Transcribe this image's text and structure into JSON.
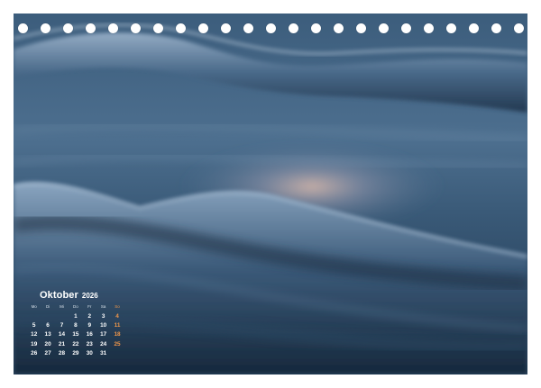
{
  "photo": {
    "subject": "long-exposure-sea-waves",
    "colors": {
      "deep": "#1c2f45",
      "mid": "#3d6080",
      "light": "#7d9cb8",
      "glow": "#d9b3a4"
    }
  },
  "binding": {
    "hole_count": 23
  },
  "calendar": {
    "month": "Oktober",
    "year": "2026",
    "weekdays": [
      "Mo",
      "Di",
      "Mi",
      "Do",
      "Fr",
      "Sa",
      "So"
    ],
    "weeks": [
      [
        "",
        "",
        "",
        "1",
        "2",
        "3",
        "4"
      ],
      [
        "5",
        "6",
        "7",
        "8",
        "9",
        "10",
        "11"
      ],
      [
        "12",
        "13",
        "14",
        "15",
        "16",
        "17",
        "18"
      ],
      [
        "19",
        "20",
        "21",
        "22",
        "23",
        "24",
        "25"
      ],
      [
        "26",
        "27",
        "28",
        "29",
        "30",
        "31",
        ""
      ]
    ],
    "sunday_color": "#f0964a"
  }
}
